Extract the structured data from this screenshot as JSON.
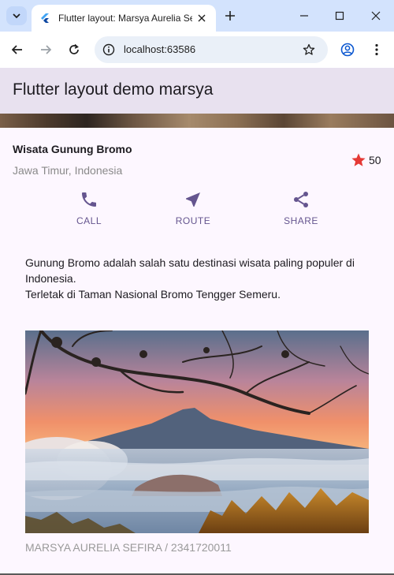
{
  "browser": {
    "tab_title": "Flutter layout: Marsya Aurelia Sefira",
    "url": "localhost:63586"
  },
  "app": {
    "title": "Flutter layout demo marsya"
  },
  "place": {
    "name": "Wisata Gunung Bromo",
    "location": "Jawa Timur, Indonesia",
    "rating": "50"
  },
  "actions": [
    {
      "label": "CALL",
      "icon": "phone-icon"
    },
    {
      "label": "ROUTE",
      "icon": "navigation-icon"
    },
    {
      "label": "SHARE",
      "icon": "share-icon"
    }
  ],
  "description": {
    "line1": "Gunung Bromo adalah salah satu destinasi wisata paling populer di Indonesia.",
    "line2": "Terletak di Taman Nasional Bromo Tengger Semeru."
  },
  "caption": "MARSYA AURELIA SEFIRA / 2341720011",
  "colors": {
    "accent": "#65558f",
    "star": "#e53935",
    "appbar": "#e8e1ef",
    "background": "#fdf7ff"
  }
}
